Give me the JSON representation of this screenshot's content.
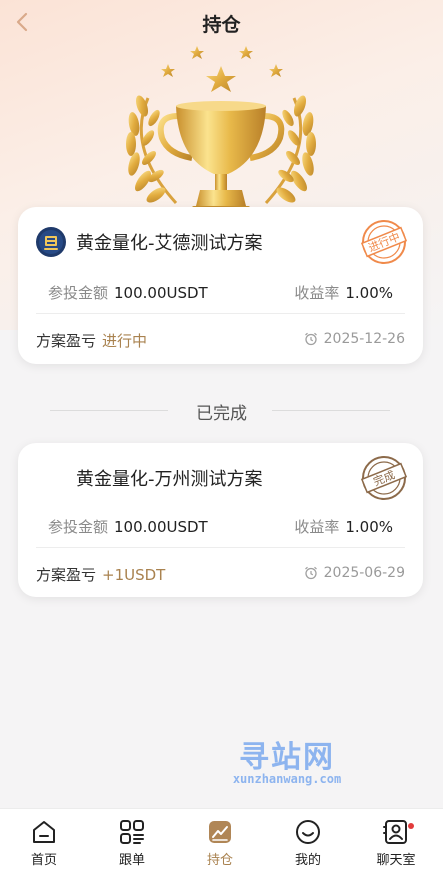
{
  "header": {
    "title": "持仓"
  },
  "active_plans": [
    {
      "name": "黄金量化-艾德测试方案",
      "stamp": "进行中",
      "amount_label": "参投金额",
      "amount_value": "100.00USDT",
      "rate_label": "收益率",
      "rate_value": "1.00%",
      "profit_label": "方案盈亏",
      "profit_value": "进行中",
      "date": "2025-12-26"
    }
  ],
  "completed_section": {
    "title": "已完成"
  },
  "completed_plans": [
    {
      "name": "黄金量化-万州测试方案",
      "stamp": "完成",
      "amount_label": "参投金额",
      "amount_value": "100.00USDT",
      "rate_label": "收益率",
      "rate_value": "1.00%",
      "profit_label": "方案盈亏",
      "profit_value": "+1USDT",
      "date": "2025-06-29"
    }
  ],
  "watermark": {
    "big": "寻站网",
    "small": "xunzhanwang.com"
  },
  "tabbar": {
    "items": [
      {
        "label": "首页",
        "icon": "home-icon"
      },
      {
        "label": "跟单",
        "icon": "grid-icon"
      },
      {
        "label": "持仓",
        "icon": "chart-icon",
        "active": true
      },
      {
        "label": "我的",
        "icon": "smile-icon"
      },
      {
        "label": "聊天室",
        "icon": "contact-icon",
        "badge": true
      }
    ]
  },
  "colors": {
    "accent": "#a9824f",
    "gold": "#e3b44b",
    "stamp_orange": "#f08a4b",
    "stamp_brown": "#8c6a4a"
  }
}
